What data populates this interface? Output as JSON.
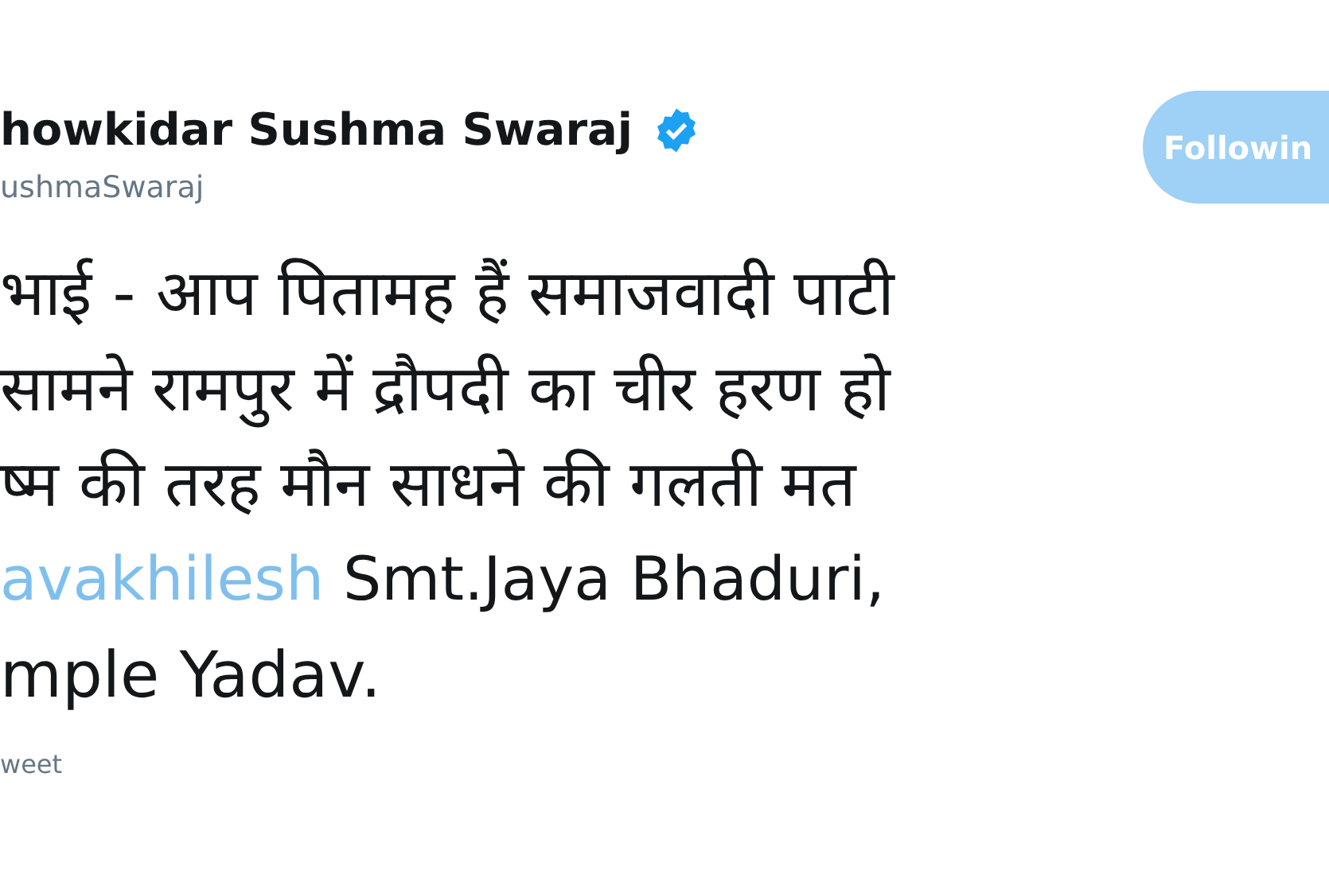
{
  "author": {
    "name": "howkidar Sushma Swaraj",
    "verified": true,
    "handle": "ushmaSwaraj"
  },
  "follow_button": {
    "label": "Followin"
  },
  "tweet_lines": [
    {
      "kind": "text",
      "text": "भाई - आप पितामह हैं समाजवादी पाटी"
    },
    {
      "kind": "text",
      "text": "सामने रामपुर में द्रौपदी का चीर हरण हो"
    },
    {
      "kind": "text",
      "text": "ष्म की तरह मौन साधने की गलती मत"
    },
    {
      "kind": "mention",
      "mention": "avakhilesh",
      "text": "Smt.Jaya Bhaduri,"
    },
    {
      "kind": "text",
      "text": "mple Yadav."
    }
  ],
  "translate_link": "weet"
}
